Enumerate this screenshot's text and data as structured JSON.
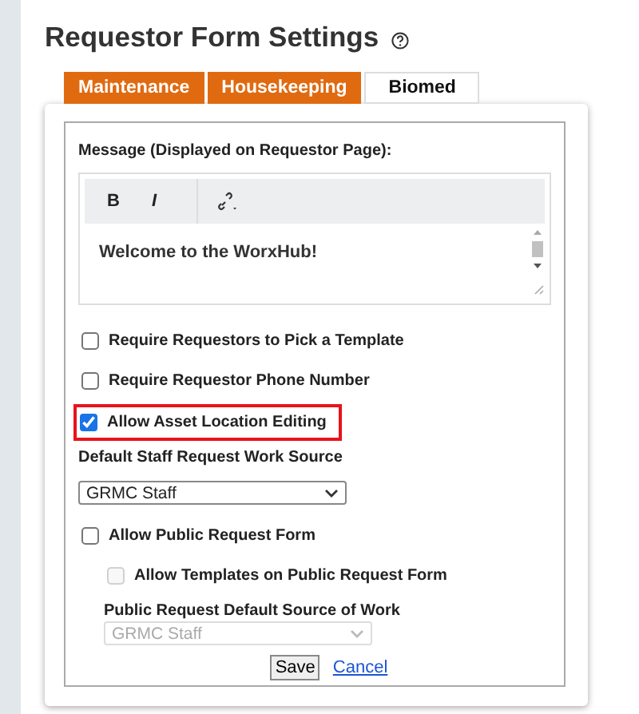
{
  "title": "Requestor Form Settings",
  "tabs": [
    {
      "label": "Maintenance",
      "selected": false
    },
    {
      "label": "Housekeeping",
      "selected": false
    },
    {
      "label": "Biomed",
      "selected": true
    }
  ],
  "message": {
    "label": "Message (Displayed on Requestor Page):",
    "toolbar": [
      "B",
      "I"
    ],
    "content": "Welcome to the WorxHub!"
  },
  "options": [
    {
      "kind": "checkbox",
      "label": "Require Requestors to Pick a Template",
      "checked": false,
      "disabled": false,
      "indented": false,
      "highlighted": false
    },
    {
      "kind": "checkbox",
      "label": "Require Requestor Phone Number",
      "checked": false,
      "disabled": false,
      "indented": false,
      "highlighted": false
    },
    {
      "kind": "checkbox",
      "label": "Allow Asset Location Editing",
      "checked": true,
      "disabled": false,
      "indented": false,
      "highlighted": true
    },
    {
      "kind": "select",
      "label": "Default Staff Request Work Source",
      "value": "GRMC Staff",
      "disabled": false,
      "indented": false
    },
    {
      "kind": "checkbox",
      "label": "Allow Public Request Form",
      "checked": false,
      "disabled": false,
      "indented": false,
      "highlighted": false
    },
    {
      "kind": "checkbox",
      "label": "Allow Templates on Public Request Form",
      "checked": false,
      "disabled": true,
      "indented": true,
      "highlighted": false
    },
    {
      "kind": "select",
      "label": "Public Request Default Source of Work",
      "value": "GRMC Staff",
      "disabled": true,
      "indented": true
    }
  ],
  "actions": {
    "save": "Save",
    "cancel": "Cancel"
  }
}
